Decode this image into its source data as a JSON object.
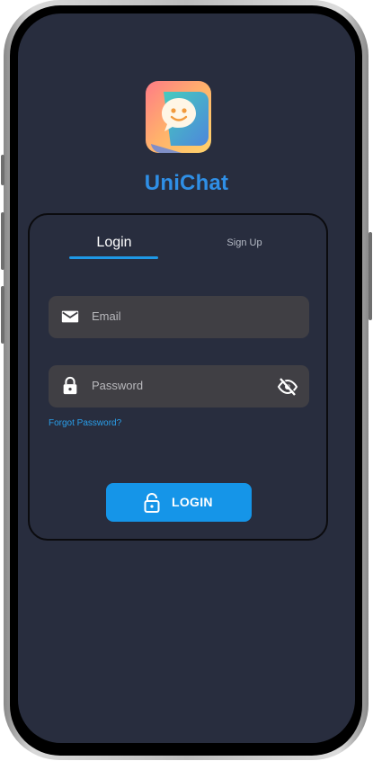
{
  "app": {
    "name": "UniChat"
  },
  "tabs": {
    "login": "Login",
    "signup": "Sign Up",
    "active": "Login"
  },
  "fields": {
    "email": {
      "placeholder": "Email",
      "icon": "mail-icon"
    },
    "password": {
      "placeholder": "Password",
      "icon": "lock-icon",
      "toggle_icon": "eye-off-icon"
    }
  },
  "links": {
    "forgot_password": "Forgot Password?"
  },
  "buttons": {
    "login": {
      "label": "LOGIN",
      "icon": "unlock-icon"
    }
  },
  "colors": {
    "background": "#282d3e",
    "accent": "#1595e8",
    "title": "#2f8fe6",
    "field_background": "#403f44"
  }
}
